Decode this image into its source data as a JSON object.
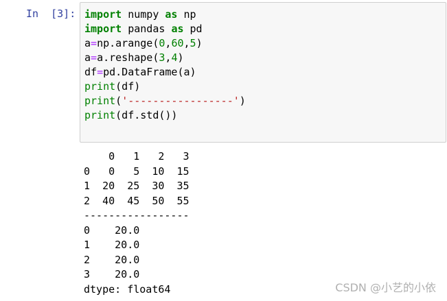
{
  "cell": {
    "prompt": "In  [3]:",
    "code_lines": [
      [
        {
          "t": "import",
          "c": "kw"
        },
        {
          "t": " numpy ",
          "c": ""
        },
        {
          "t": "as",
          "c": "kw"
        },
        {
          "t": " np",
          "c": ""
        }
      ],
      [
        {
          "t": "import",
          "c": "kw"
        },
        {
          "t": " pandas ",
          "c": ""
        },
        {
          "t": "as",
          "c": "kw"
        },
        {
          "t": " pd",
          "c": ""
        }
      ],
      [
        {
          "t": "a",
          "c": ""
        },
        {
          "t": "=",
          "c": "op"
        },
        {
          "t": "np.arange(",
          "c": ""
        },
        {
          "t": "0",
          "c": "num"
        },
        {
          "t": ",",
          "c": ""
        },
        {
          "t": "60",
          "c": "num"
        },
        {
          "t": ",",
          "c": ""
        },
        {
          "t": "5",
          "c": "num"
        },
        {
          "t": ")",
          "c": ""
        }
      ],
      [
        {
          "t": "a",
          "c": ""
        },
        {
          "t": "=",
          "c": "op"
        },
        {
          "t": "a.reshape(",
          "c": ""
        },
        {
          "t": "3",
          "c": "num"
        },
        {
          "t": ",",
          "c": ""
        },
        {
          "t": "4",
          "c": "num"
        },
        {
          "t": ")",
          "c": ""
        }
      ],
      [
        {
          "t": "df",
          "c": ""
        },
        {
          "t": "=",
          "c": "op"
        },
        {
          "t": "pd.DataFrame(a)",
          "c": ""
        }
      ],
      [
        {
          "t": "print",
          "c": "fn"
        },
        {
          "t": "(df)",
          "c": ""
        }
      ],
      [
        {
          "t": "print",
          "c": "fn"
        },
        {
          "t": "(",
          "c": ""
        },
        {
          "t": "'-----------------'",
          "c": "str"
        },
        {
          "t": ")",
          "c": ""
        }
      ],
      [
        {
          "t": "print",
          "c": "fn"
        },
        {
          "t": "(df.std())",
          "c": ""
        }
      ]
    ]
  },
  "output": {
    "lines": [
      "    0   1   2   3",
      "0   0   5  10  15",
      "1  20  25  30  35",
      "2  40  45  50  55",
      "-----------------",
      "0    20.0",
      "1    20.0",
      "2    20.0",
      "3    20.0",
      "dtype: float64"
    ]
  },
  "watermark": "CSDN @小艺的小依"
}
